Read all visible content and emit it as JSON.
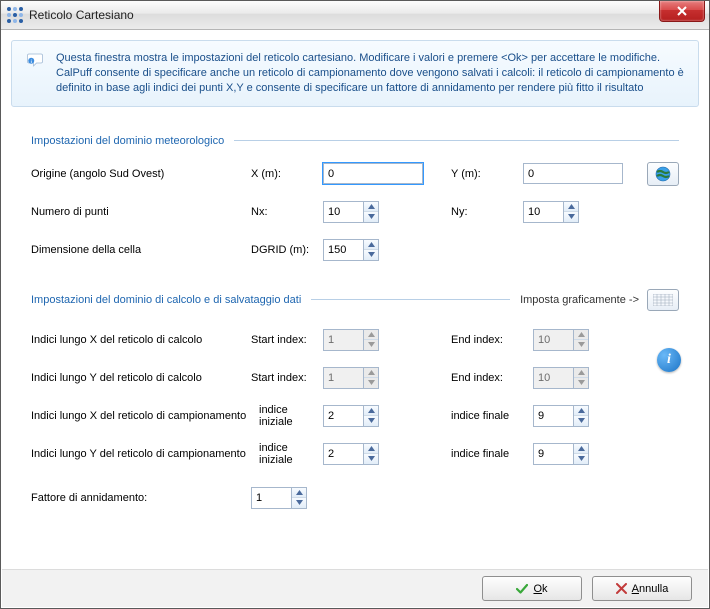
{
  "window": {
    "title": "Reticolo Cartesiano"
  },
  "banner": {
    "text": "Questa finestra mostra le impostazioni del reticolo cartesiano. Modificare i valori e premere <Ok> per accettare le modifiche. CalPuff consente di specificare anche un reticolo di campionamento dove vengono salvati i calcoli: il reticolo di campionamento è definito in base agli indici dei punti X,Y e consente di specificare un fattore di annidamento per rendere più fitto il risultato"
  },
  "section1": {
    "title": "Impostazioni del dominio meteorologico",
    "origin": {
      "label": "Origine (angolo Sud Ovest)",
      "x_label": "X (m):",
      "x_value": "0",
      "y_label": "Y (m):",
      "y_value": "0"
    },
    "npoints": {
      "label": "Numero di punti",
      "nx_label": "Nx:",
      "nx_value": "10",
      "ny_label": "Ny:",
      "ny_value": "10"
    },
    "cell": {
      "label": "Dimensione della cella",
      "dgrid_label": "DGRID (m):",
      "dgrid_value": "150"
    }
  },
  "section2": {
    "title": "Impostazioni del dominio di calcolo e di salvataggio dati",
    "graphical_label": "Imposta graficamente ->",
    "calc_x": {
      "label": "Indici lungo X del reticolo di calcolo",
      "start_label": "Start index:",
      "start_value": "1",
      "end_label": "End index:",
      "end_value": "10"
    },
    "calc_y": {
      "label": "Indici lungo Y del reticolo di calcolo",
      "start_label": "Start index:",
      "start_value": "1",
      "end_label": "End index:",
      "end_value": "10"
    },
    "samp_x": {
      "label": "Indici lungo X del reticolo di campionamento",
      "start_label": "indice iniziale",
      "start_value": "2",
      "end_label": "indice finale",
      "end_value": "9"
    },
    "samp_y": {
      "label": "Indici lungo Y del reticolo di campionamento",
      "start_label": "indice iniziale",
      "start_value": "2",
      "end_label": "indice finale",
      "end_value": "9"
    },
    "nest": {
      "label": "Fattore di annidamento:",
      "value": "1"
    }
  },
  "buttons": {
    "ok_prefix": "O",
    "ok_rest": "k",
    "cancel_prefix": "A",
    "cancel_rest": "nnulla"
  }
}
